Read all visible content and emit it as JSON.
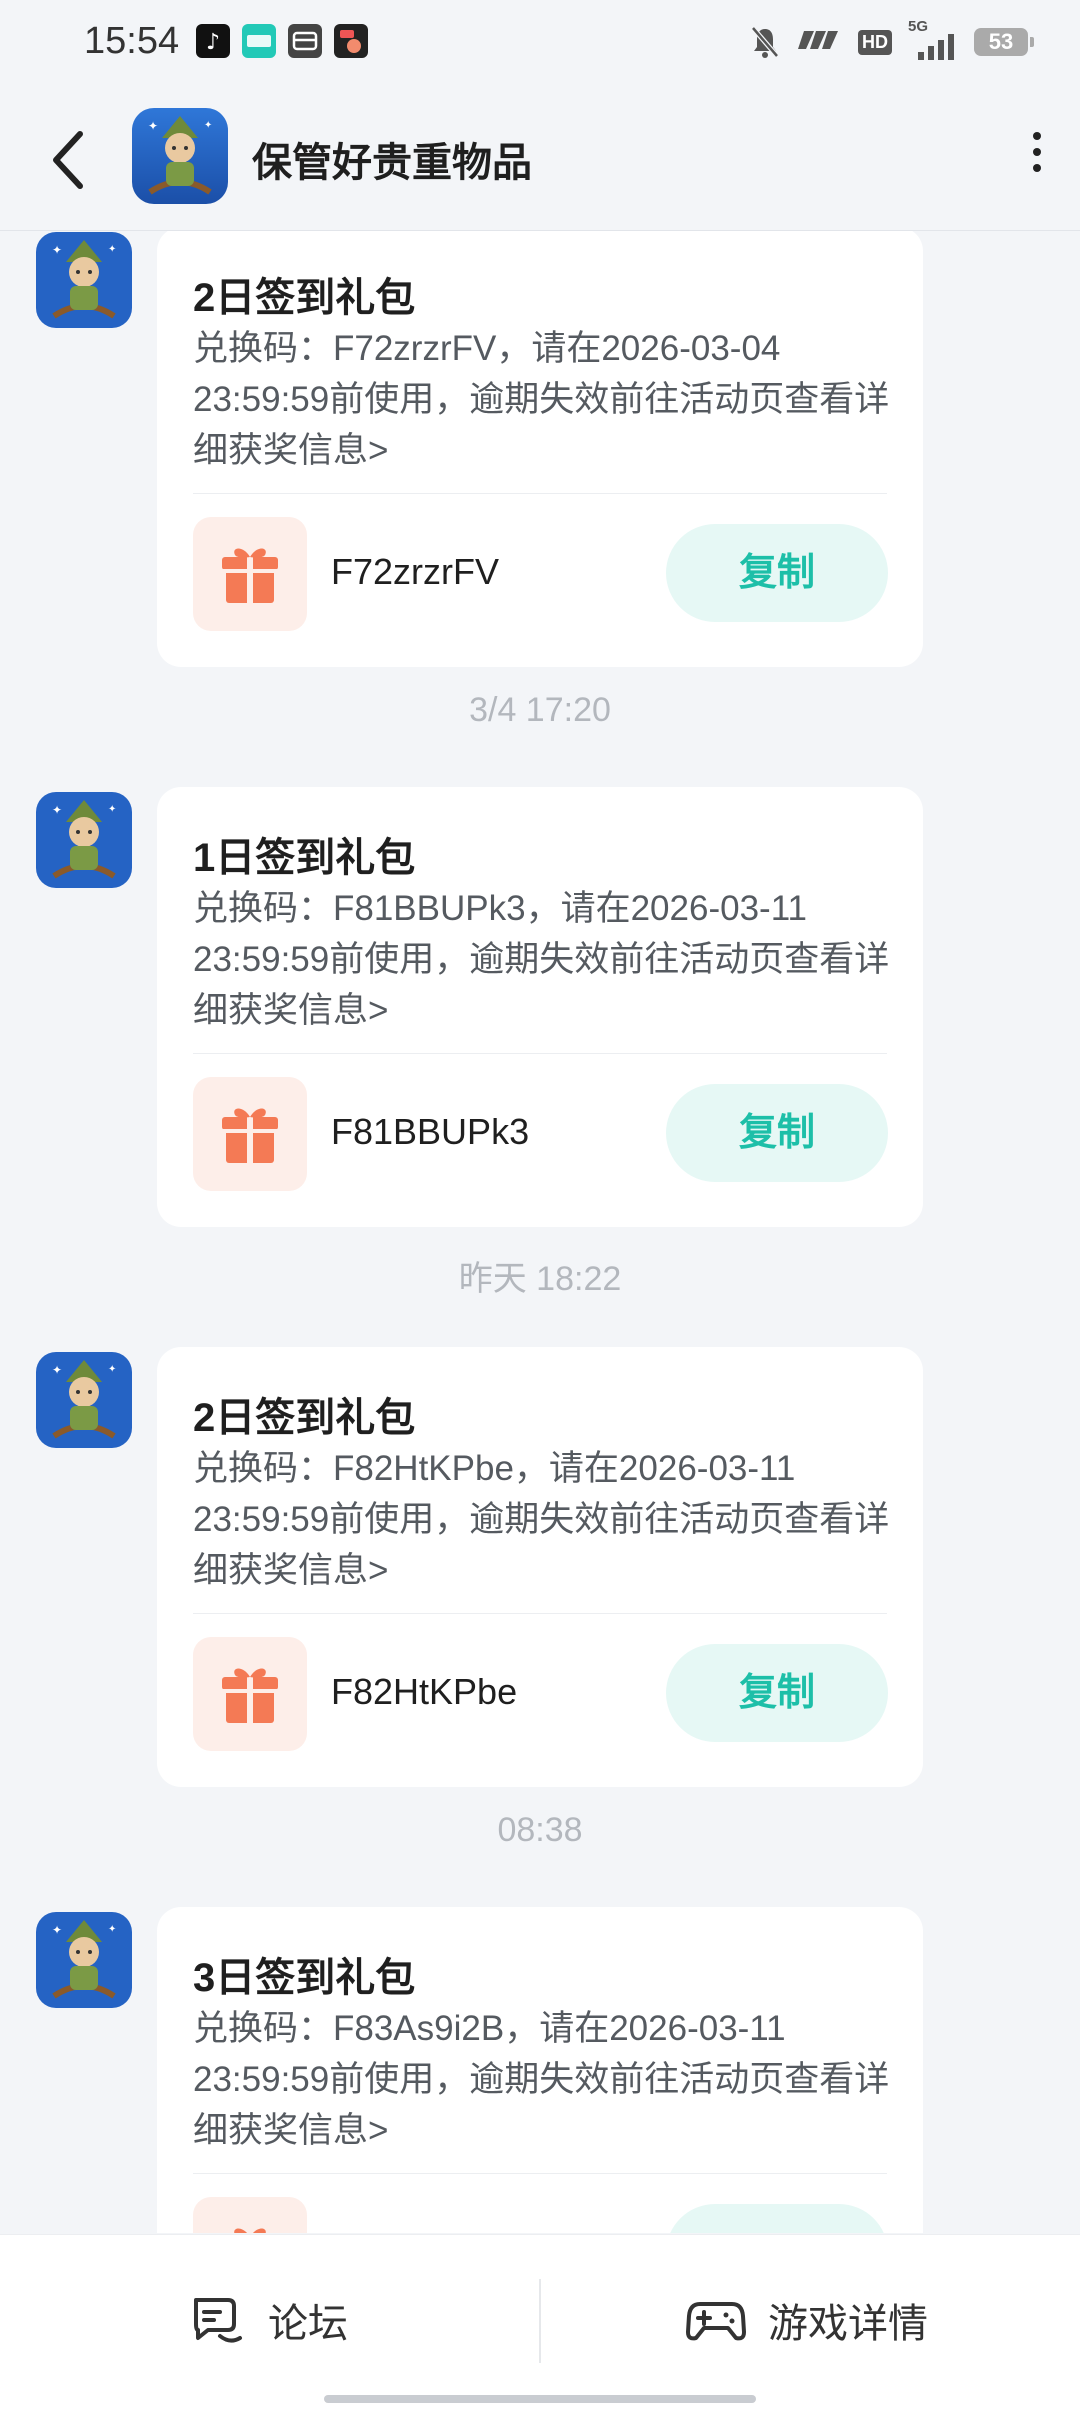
{
  "status_bar": {
    "time": "15:54",
    "network": "5G",
    "hd_label": "HD",
    "battery": "53"
  },
  "header": {
    "title": "保管好贵重物品"
  },
  "messages": [
    {
      "timestamp": "",
      "title": "2日签到礼包",
      "description": "兑换码：F72zrzrFV，请在2026-03-04 23:59:59前使用，逾期失效前往活动页查看详细获奖信息>",
      "code": "F72zrzrFV",
      "copy_label": "复制"
    },
    {
      "timestamp": "3/4  17:20",
      "title": "1日签到礼包",
      "description": "兑换码：F81BBUPk3，请在2026-03-11 23:59:59前使用，逾期失效前往活动页查看详细获奖信息>",
      "code": "F81BBUPk3",
      "copy_label": "复制"
    },
    {
      "timestamp": "昨天  18:22",
      "title": "2日签到礼包",
      "description": "兑换码：F82HtKPbe，请在2026-03-11 23:59:59前使用，逾期失效前往活动页查看详细获奖信息>",
      "code": "F82HtKPbe",
      "copy_label": "复制"
    },
    {
      "timestamp": "08:38",
      "title": "3日签到礼包",
      "description": "兑换码：F83As9i2B，请在2026-03-11 23:59:59前使用，逾期失效前往活动页查看详细获奖信息>",
      "code": "",
      "copy_label": ""
    }
  ],
  "bottom_nav": {
    "forum_label": "论坛",
    "game_details_label": "游戏详情"
  },
  "colors": {
    "accent": "#1dbfa8",
    "accent_bg": "#e6f8f5",
    "gift": "#f47a55",
    "gift_bg": "#fdeee9",
    "background": "#f3f5f8"
  },
  "icons": [
    "back-arrow-icon",
    "more-vertical-icon",
    "gift-icon",
    "forum-chat-icon",
    "gamepad-icon",
    "mute-bell-icon"
  ]
}
